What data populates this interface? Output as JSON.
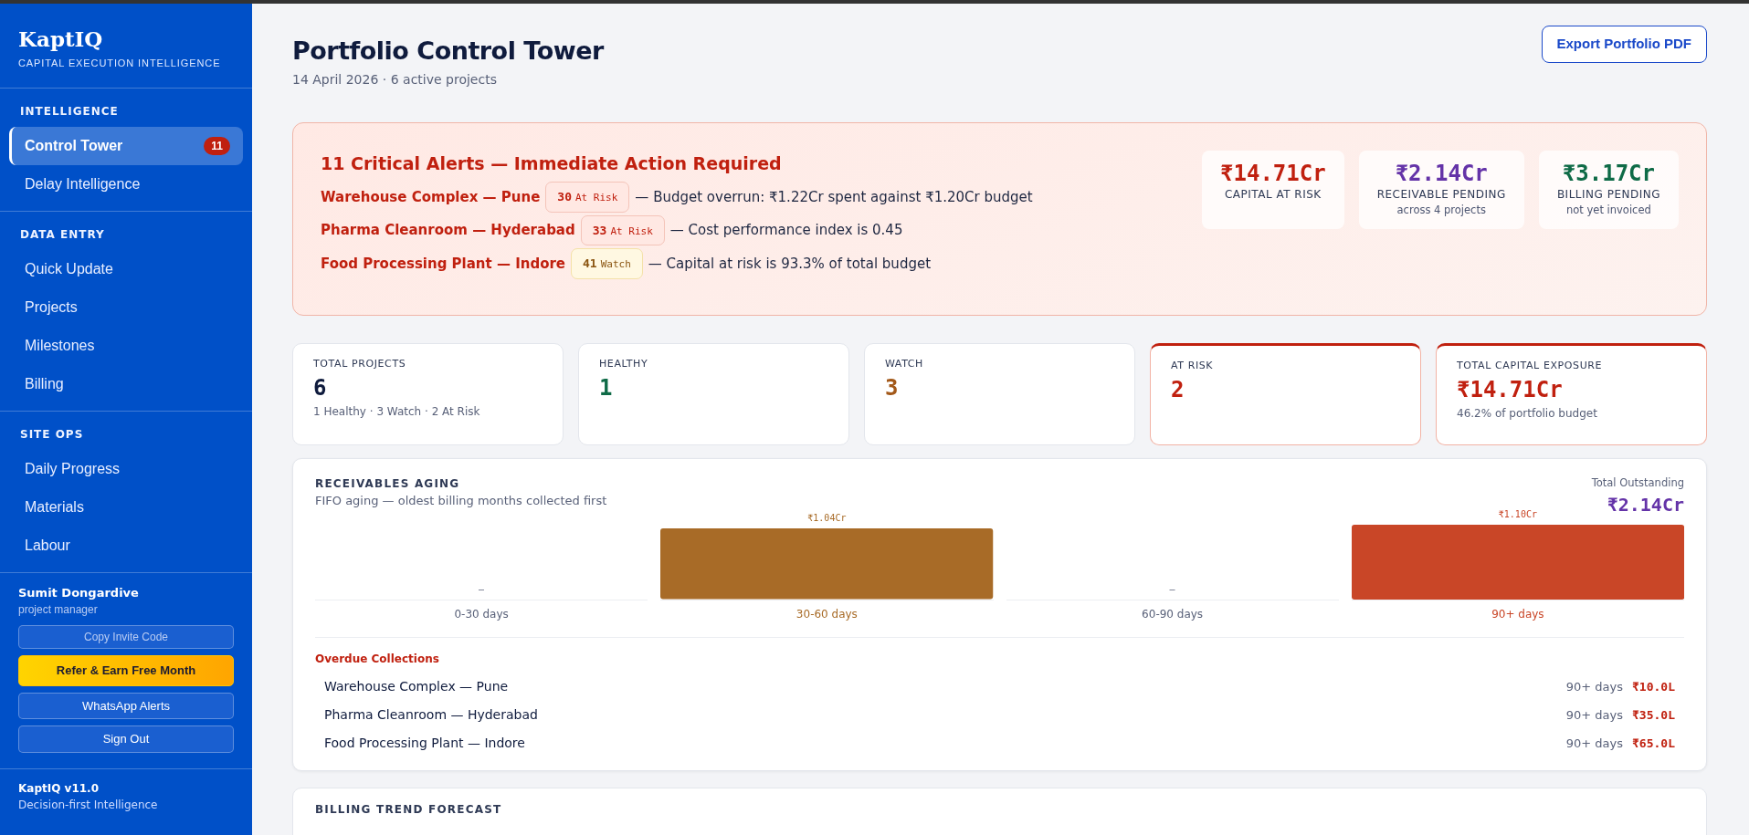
{
  "sidebar": {
    "brand": "KaptIQ",
    "tagline": "CAPITAL EXECUTION INTELLIGENCE",
    "sections": [
      {
        "heading": "INTELLIGENCE",
        "items": [
          {
            "label": "Control Tower",
            "selected": true,
            "badge": "11"
          },
          {
            "label": "Delay Intelligence",
            "selected": false
          }
        ]
      },
      {
        "heading": "DATA ENTRY",
        "items": [
          {
            "label": "Quick Update",
            "selected": false
          },
          {
            "label": "Projects",
            "selected": false
          },
          {
            "label": "Milestones",
            "selected": false
          },
          {
            "label": "Billing",
            "selected": false
          }
        ]
      },
      {
        "heading": "SITE OPS",
        "items": [
          {
            "label": "Daily Progress",
            "selected": false
          },
          {
            "label": "Materials",
            "selected": false
          },
          {
            "label": "Labour",
            "selected": false
          }
        ]
      }
    ],
    "user": {
      "name": "Sumit Dongardive",
      "role": "project manager"
    },
    "buttons": [
      {
        "label": "Copy Invite Code",
        "kind": "muted"
      },
      {
        "label": "Refer & Earn Free Month",
        "kind": "promo"
      },
      {
        "label": "WhatsApp Alerts",
        "kind": "outline"
      },
      {
        "label": "Sign Out",
        "kind": "outline"
      }
    ],
    "footer": {
      "version": "KaptIQ v11.0",
      "tagline": "Decision-first Intelligence"
    }
  },
  "header": {
    "title": "Portfolio Control Tower",
    "subtitle": "14 April 2026 · 6 active projects",
    "export_button": "Export Portfolio PDF"
  },
  "alerts": {
    "title": "11 Critical Alerts — Immediate Action Required",
    "items": [
      {
        "project": "Warehouse Complex — Pune",
        "score": "30",
        "status": "At Risk",
        "kind": "risk",
        "message": "— Budget overrun: ₹1.22Cr spent against ₹1.20Cr budget"
      },
      {
        "project": "Pharma Cleanroom — Hyderabad",
        "score": "33",
        "status": "At Risk",
        "kind": "risk",
        "message": "— Cost performance index is 0.45"
      },
      {
        "project": "Food Processing Plant — Indore",
        "score": "41",
        "status": "Watch",
        "kind": "watch",
        "message": "— Capital at risk is 93.3% of total budget"
      }
    ],
    "summary": [
      {
        "value": "₹14.71Cr",
        "label": "CAPITAL AT RISK",
        "color": "#c0200f"
      },
      {
        "value": "₹2.14Cr",
        "label": "RECEIVABLE PENDING",
        "note": "across 4 projects",
        "color": "#6433a8"
      },
      {
        "value": "₹3.17Cr",
        "label": "BILLING PENDING",
        "note": "not yet invoiced",
        "color": "#0f6b47"
      }
    ]
  },
  "kpis": [
    {
      "label": "TOTAL PROJECTS",
      "value": "6",
      "note": "1 Healthy · 3 Watch · 2 At Risk",
      "color": "#0f1b3d",
      "highlighted": false
    },
    {
      "label": "HEALTHY",
      "value": "1",
      "color": "#0f6b47",
      "highlighted": false
    },
    {
      "label": "WATCH",
      "value": "3",
      "color": "#a3591a",
      "highlighted": false
    },
    {
      "label": "AT RISK",
      "value": "2",
      "color": "#c0200f",
      "highlighted": true
    },
    {
      "label": "TOTAL CAPITAL EXPOSURE",
      "value": "₹14.71Cr",
      "note": "46.2% of portfolio budget",
      "color": "#c0200f",
      "highlighted": true
    }
  ],
  "receivables": {
    "title": "RECEIVABLES AGING",
    "subtitle": "FIFO aging — oldest billing months collected first",
    "total_label": "Total Outstanding",
    "total": "₹2.14Cr",
    "chart_data": {
      "type": "bar",
      "categories": [
        "0-30 days",
        "30-60 days",
        "60-90 days",
        "90+ days"
      ],
      "values": [
        null,
        1.04,
        null,
        1.1
      ],
      "value_labels": [
        "–",
        "₹1.04Cr",
        "–",
        "₹1.10Cr"
      ],
      "colors": [
        "#596179",
        "#a86b27",
        "#596179",
        "#c94627"
      ]
    },
    "overdue_title": "Overdue Collections",
    "overdue": [
      {
        "project": "Warehouse Complex — Pune",
        "age": "90+ days",
        "amount": "₹10.0L"
      },
      {
        "project": "Pharma Cleanroom — Hyderabad",
        "age": "90+ days",
        "amount": "₹35.0L"
      },
      {
        "project": "Food Processing Plant — Indore",
        "age": "90+ days",
        "amount": "₹65.0L"
      }
    ]
  },
  "next_card": {
    "title": "BILLING TREND FORECAST"
  }
}
